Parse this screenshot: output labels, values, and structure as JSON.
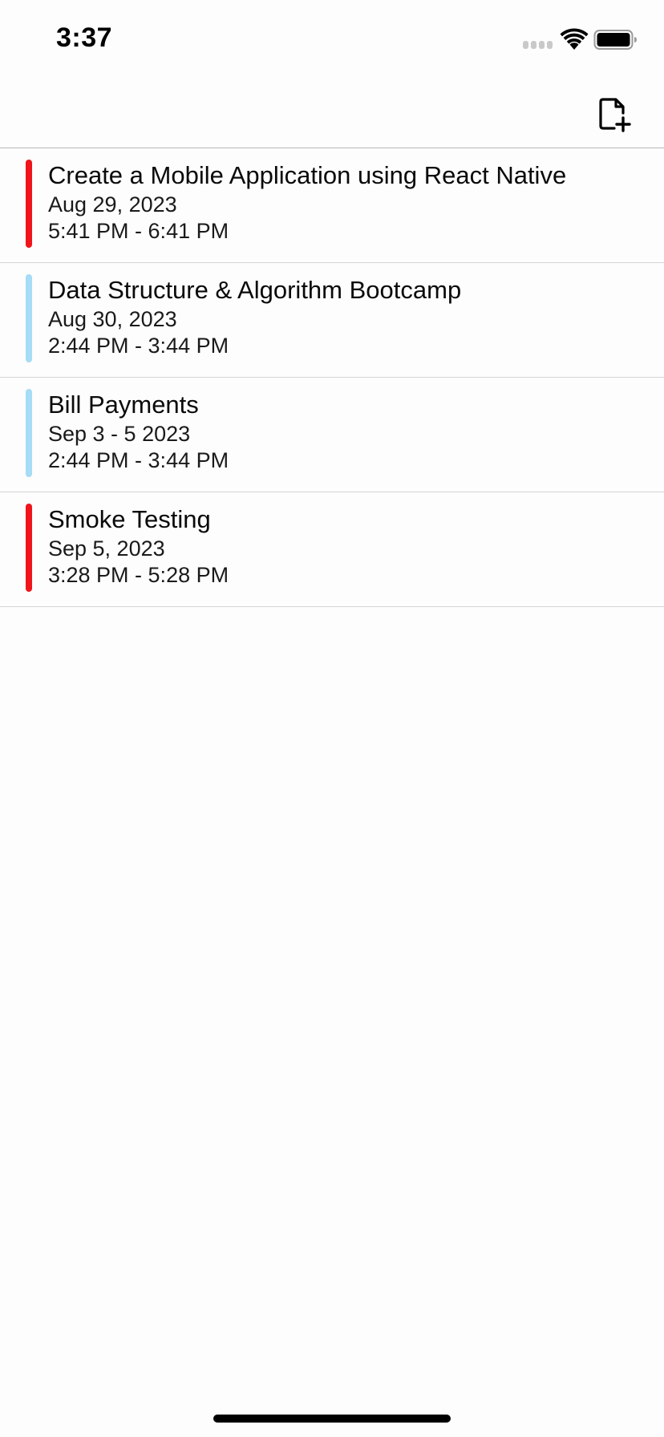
{
  "status_bar": {
    "time": "3:37",
    "signal_icon": "cellular-signal-icon",
    "wifi_icon": "wifi-icon",
    "battery_icon": "battery-icon"
  },
  "header": {
    "add_icon": "add-file-icon"
  },
  "tasks": [
    {
      "title": "Create a Mobile Application using React Native",
      "date": "Aug 29, 2023",
      "time": "5:41 PM - 6:41 PM",
      "color": "#f0141b"
    },
    {
      "title": "Data Structure & Algorithm Bootcamp",
      "date": "Aug 30, 2023",
      "time": "2:44 PM - 3:44 PM",
      "color": "#a6dcf5"
    },
    {
      "title": "Bill Payments",
      "date": "Sep 3 - 5 2023",
      "time": "2:44 PM - 3:44 PM",
      "color": "#a6dcf5"
    },
    {
      "title": "Smoke Testing",
      "date": "Sep 5, 2023",
      "time": "3:28 PM - 5:28 PM",
      "color": "#f0141b"
    }
  ]
}
